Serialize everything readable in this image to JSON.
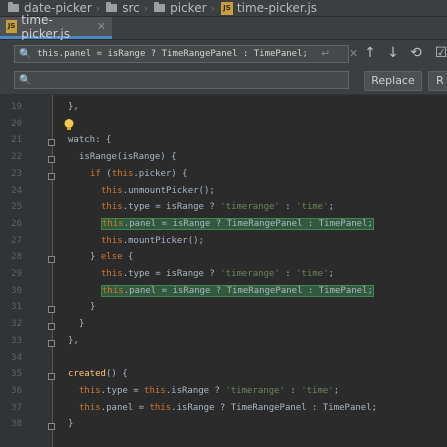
{
  "breadcrumb": [
    "date-picker",
    "src",
    "picker",
    "time-picker.js"
  ],
  "tab": {
    "label": "time-picker.js"
  },
  "find": {
    "search_value": "this.panel = isRange ? TimeRangePanel : TimePanel;",
    "replace_value": "",
    "replace_label": "Replace",
    "replace_all_label": "R"
  },
  "editor": {
    "line_numbers": [
      "19",
      "20",
      "21",
      "22",
      "23",
      "24",
      "25",
      "26",
      "27",
      "28",
      "29",
      "30",
      "31",
      "32",
      "33",
      "34",
      "35",
      "36",
      "37",
      "38"
    ],
    "lines": [
      {
        "indent": 0,
        "tokens": [
          {
            "t": "},",
            "c": "p"
          }
        ]
      },
      {
        "indent": 0,
        "tokens": [
          {
            "t": "",
            "c": "p"
          }
        ]
      },
      {
        "indent": 0,
        "tokens": [
          {
            "t": "watch",
            "c": "p"
          },
          {
            "t": ": {",
            "c": "p"
          }
        ]
      },
      {
        "indent": 1,
        "tokens": [
          {
            "t": "isRange(isRange) {",
            "c": "p"
          }
        ]
      },
      {
        "indent": 2,
        "tokens": [
          {
            "t": "if",
            "c": "k"
          },
          {
            "t": " (",
            "c": "p"
          },
          {
            "t": "this",
            "c": "k"
          },
          {
            "t": ".picker) {",
            "c": "p"
          }
        ]
      },
      {
        "indent": 3,
        "tokens": [
          {
            "t": "this",
            "c": "k"
          },
          {
            "t": ".unmountPicker();",
            "c": "p"
          }
        ]
      },
      {
        "indent": 3,
        "tokens": [
          {
            "t": "this",
            "c": "k"
          },
          {
            "t": ".type = isRange ? ",
            "c": "p"
          },
          {
            "t": "'timerange'",
            "c": "s"
          },
          {
            "t": " : ",
            "c": "p"
          },
          {
            "t": "'time'",
            "c": "s"
          },
          {
            "t": ";",
            "c": "p"
          }
        ]
      },
      {
        "indent": 3,
        "hl": true,
        "tokens": [
          {
            "t": "this",
            "c": "k"
          },
          {
            "t": ".panel = isRange ? TimeRangePanel : TimePanel;",
            "c": "p"
          }
        ]
      },
      {
        "indent": 3,
        "tokens": [
          {
            "t": "this",
            "c": "k"
          },
          {
            "t": ".mountPicker();",
            "c": "p"
          }
        ]
      },
      {
        "indent": 2,
        "tokens": [
          {
            "t": "} ",
            "c": "p"
          },
          {
            "t": "else",
            "c": "k"
          },
          {
            "t": " {",
            "c": "p"
          }
        ]
      },
      {
        "indent": 3,
        "tokens": [
          {
            "t": "this",
            "c": "k"
          },
          {
            "t": ".type = isRange ? ",
            "c": "p"
          },
          {
            "t": "'timerange'",
            "c": "s"
          },
          {
            "t": " : ",
            "c": "p"
          },
          {
            "t": "'time'",
            "c": "s"
          },
          {
            "t": ";",
            "c": "p"
          }
        ]
      },
      {
        "indent": 3,
        "hl": true,
        "tokens": [
          {
            "t": "this",
            "c": "k"
          },
          {
            "t": ".panel = isRange ? TimeRangePanel : TimePanel;",
            "c": "p"
          }
        ]
      },
      {
        "indent": 2,
        "tokens": [
          {
            "t": "}",
            "c": "p"
          }
        ]
      },
      {
        "indent": 1,
        "tokens": [
          {
            "t": "}",
            "c": "p"
          }
        ]
      },
      {
        "indent": 0,
        "tokens": [
          {
            "t": "},",
            "c": "p"
          }
        ]
      },
      {
        "indent": 0,
        "tokens": [
          {
            "t": "",
            "c": "p"
          }
        ]
      },
      {
        "indent": 0,
        "tokens": [
          {
            "t": "created",
            "c": "f"
          },
          {
            "t": "() {",
            "c": "p"
          }
        ]
      },
      {
        "indent": 1,
        "tokens": [
          {
            "t": "this",
            "c": "k"
          },
          {
            "t": ".type = ",
            "c": "p"
          },
          {
            "t": "this",
            "c": "k"
          },
          {
            "t": ".isRange ? ",
            "c": "p"
          },
          {
            "t": "'timerange'",
            "c": "s"
          },
          {
            "t": " : ",
            "c": "p"
          },
          {
            "t": "'time'",
            "c": "s"
          },
          {
            "t": ";",
            "c": "p"
          }
        ]
      },
      {
        "indent": 1,
        "tokens": [
          {
            "t": "this",
            "c": "k"
          },
          {
            "t": ".panel = ",
            "c": "p"
          },
          {
            "t": "this",
            "c": "k"
          },
          {
            "t": ".isRange ? TimeRangePanel : TimePanel;",
            "c": "p"
          }
        ]
      },
      {
        "indent": 0,
        "tokens": [
          {
            "t": "}",
            "c": "p"
          }
        ]
      }
    ]
  },
  "colors": {
    "background": "#2b2b2b",
    "keyword": "#cc7832",
    "string": "#6a8759",
    "function": "#ffc66d",
    "match_highlight": "#32593d"
  }
}
